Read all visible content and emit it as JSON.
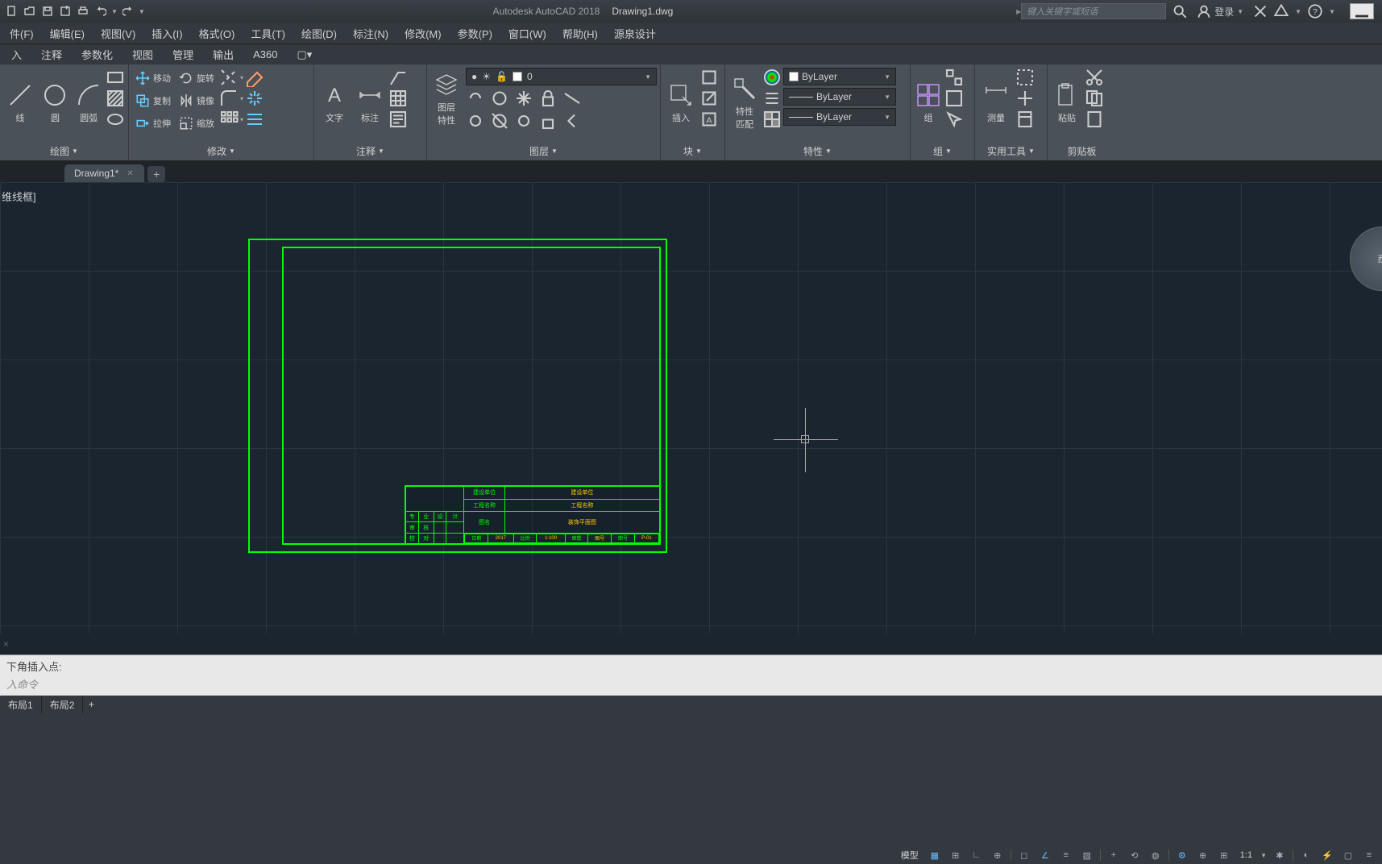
{
  "titlebar": {
    "app_name": "Autodesk AutoCAD 2018",
    "doc_name": "Drawing1.dwg",
    "search_placeholder": "键入关键字或短语",
    "login_label": "登录"
  },
  "menubar": {
    "items": [
      {
        "label": "件(F)"
      },
      {
        "label": "编辑(E)"
      },
      {
        "label": "视图(V)"
      },
      {
        "label": "插入(I)"
      },
      {
        "label": "格式(O)"
      },
      {
        "label": "工具(T)"
      },
      {
        "label": "绘图(D)"
      },
      {
        "label": "标注(N)"
      },
      {
        "label": "修改(M)"
      },
      {
        "label": "参数(P)"
      },
      {
        "label": "窗口(W)"
      },
      {
        "label": "帮助(H)"
      },
      {
        "label": "源泉设计"
      }
    ]
  },
  "ribbon_tabs": {
    "items": [
      {
        "label": "入"
      },
      {
        "label": "注释"
      },
      {
        "label": "参数化"
      },
      {
        "label": "视图"
      },
      {
        "label": "管理"
      },
      {
        "label": "输出"
      },
      {
        "label": "A360"
      }
    ]
  },
  "ribbon": {
    "draw": {
      "title": "绘图",
      "line": "线",
      "circle": "圆",
      "arc": "圆弧"
    },
    "modify": {
      "title": "修改",
      "move": "移动",
      "rotate": "旋转",
      "copy": "复制",
      "mirror": "镜像",
      "stretch": "拉伸",
      "scale": "缩放"
    },
    "annotate": {
      "title": "注释",
      "text": "文字",
      "dim": "标注"
    },
    "layers": {
      "title": "图层",
      "props": "图层\n特性",
      "current": "0"
    },
    "block": {
      "title": "块",
      "insert": "插入"
    },
    "properties": {
      "title": "特性",
      "match": "特性\n匹配",
      "bylayer": "ByLayer"
    },
    "group": {
      "title": "组",
      "label": "组"
    },
    "utilities": {
      "title": "实用工具",
      "measure": "测量"
    },
    "clipboard": {
      "title": "剪贴板",
      "paste": "粘贴"
    }
  },
  "filetabs": {
    "tab1": "Drawing1*"
  },
  "canvas": {
    "viewport_label": "维线框]",
    "nav_label": "西"
  },
  "title_block": {
    "row1": {
      "c1": "建设单位",
      "c2": "建设单位"
    },
    "row2": {
      "c1": "工程名称",
      "c2": "工程名称"
    },
    "row3": {
      "a1": "专",
      "a2": "业",
      "b1": "设",
      "b2": "计",
      "c1": "图名",
      "c2": "装饰平面图"
    },
    "row4": {
      "a1": "审",
      "a2": "核"
    },
    "row5": {
      "a1": "校",
      "a2": "对",
      "c1": "日期",
      "c2": "2017",
      "c3": "比例",
      "c4": "1:100",
      "c5": "图数",
      "c6": "图号",
      "c7": "图号",
      "c8": "P-01"
    }
  },
  "cmdline": {
    "history": "下角插入点:",
    "prompt": "入命令",
    "x_label": "×"
  },
  "layout_tabs": {
    "t1": "布局1",
    "t2": "布局2"
  },
  "statusbar": {
    "model": "模型",
    "scale": "1:1"
  }
}
